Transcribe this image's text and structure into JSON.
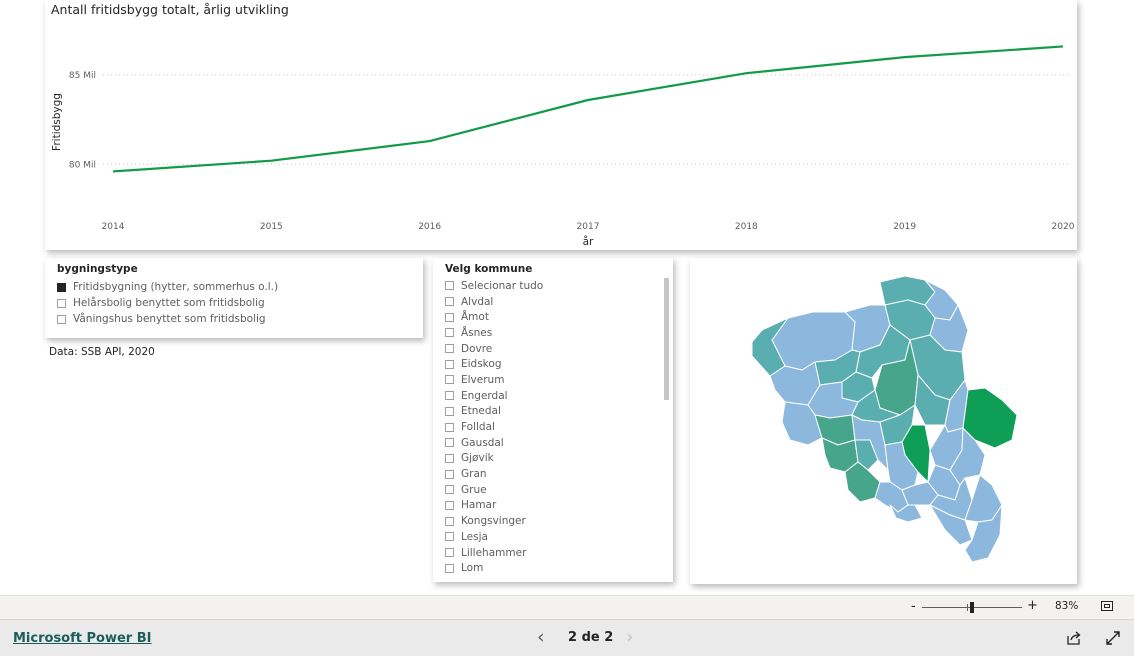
{
  "chart": {
    "title": "Antall fritidsbygg totalt, årlig utvikling",
    "y_axis_title": "Fritidsbygg",
    "x_axis_title": "år"
  },
  "chart_data": {
    "type": "line",
    "title": "Antall fritidsbygg totalt, årlig utvikling",
    "xlabel": "år",
    "ylabel": "Fritidsbygg",
    "x": [
      "2014",
      "2015",
      "2016",
      "2017",
      "2018",
      "2019",
      "2020"
    ],
    "series": [
      {
        "values": [
          79.6,
          80.2,
          81.3,
          83.6,
          85.1,
          86.0,
          86.6
        ],
        "color": "#119a48"
      }
    ],
    "y_ticks": [
      {
        "value": 80,
        "label": "80 Mil"
      },
      {
        "value": 85,
        "label": "85 Mil"
      }
    ],
    "ylim": [
      78.0,
      87.8
    ],
    "grid": true
  },
  "bygningstype": {
    "title": "bygningstype",
    "options": [
      {
        "label": "Fritidsbygning (hytter, sommerhus o.l.)",
        "checked": true
      },
      {
        "label": "Helårsbolig benyttet som fritidsbolig",
        "checked": false
      },
      {
        "label": "Våningshus benyttet som fritidsbolig",
        "checked": false
      }
    ]
  },
  "source": "Data: SSB API, 2020",
  "kommune": {
    "title": "Velg kommune",
    "options": [
      "Selecionar tudo",
      "Alvdal",
      "Åmot",
      "Åsnes",
      "Dovre",
      "Eidskog",
      "Elverum",
      "Engerdal",
      "Etnedal",
      "Folldal",
      "Gausdal",
      "Gjøvik",
      "Gran",
      "Grue",
      "Hamar",
      "Kongsvinger",
      "Lesja",
      "Lillehammer",
      "Lom"
    ]
  },
  "map": {
    "colors": {
      "light": "#8db8dd",
      "mid": "#5aaeb0",
      "strong": "#47a58b",
      "highlight": "#0e9e55",
      "border": "#ffffff"
    }
  },
  "zoom": {
    "minus": "-",
    "plus": "+",
    "value": "83%",
    "level": 0.5
  },
  "footer": {
    "link": "Microsoft Power BI",
    "page_indicator": "2 de 2",
    "prev": "‹",
    "next": "›"
  }
}
